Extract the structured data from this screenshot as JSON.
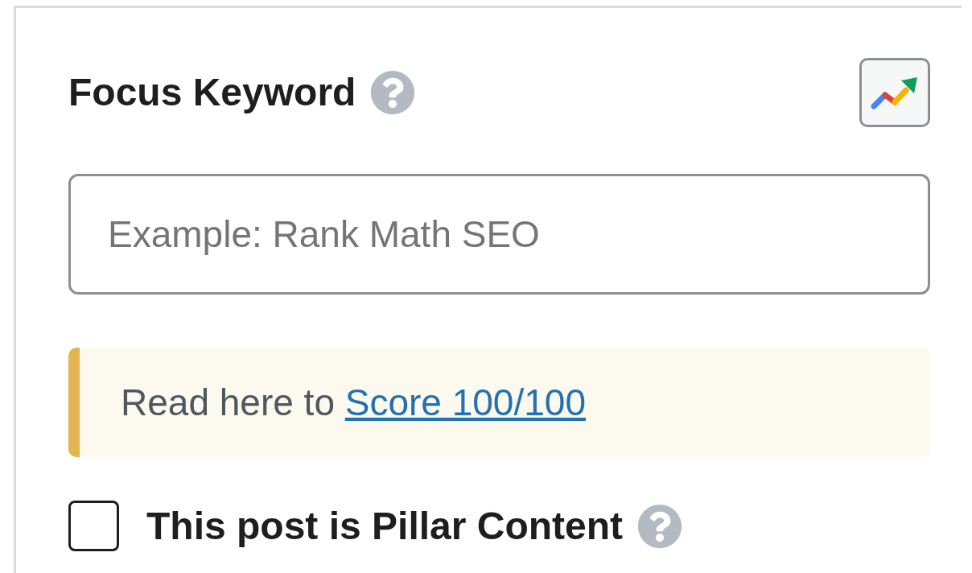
{
  "focus_keyword": {
    "label": "Focus Keyword",
    "field": {
      "placeholder": "Example: Rank Math SEO"
    }
  },
  "notice": {
    "text": "Read here to",
    "link": "Score 100/100"
  },
  "pillar_content": {
    "label": "This post is Pillar Content",
    "checked": false
  }
}
